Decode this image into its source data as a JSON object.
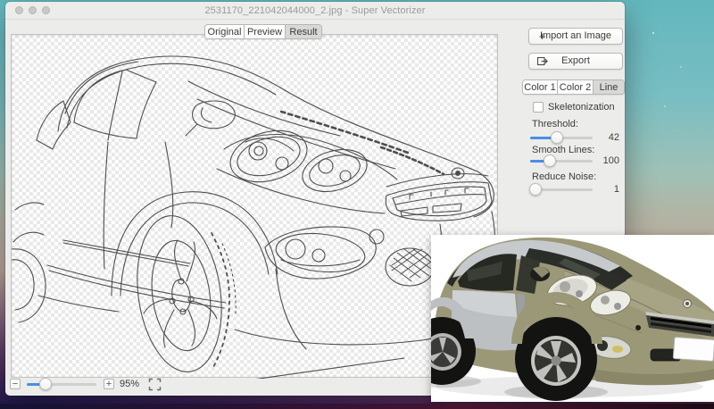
{
  "window": {
    "title": "2531170_221042044000_2.jpg - Super Vectorizer"
  },
  "view_tabs": [
    {
      "label": "Original"
    },
    {
      "label": "Preview"
    },
    {
      "label": "Result"
    }
  ],
  "active_view_tab": "Result",
  "actions": {
    "import_label": "Import an Image",
    "export_label": "Export",
    "import_icon": "+"
  },
  "mode_tabs": [
    {
      "label": "Color 1"
    },
    {
      "label": "Color 2"
    },
    {
      "label": "Line"
    }
  ],
  "active_mode_tab": "Line",
  "settings": {
    "skeletonization": {
      "label": "Skeletonization",
      "checked": false
    },
    "threshold": {
      "label": "Threshold:",
      "value": "42",
      "fill": "43%"
    },
    "smooth_lines": {
      "label": "Smooth Lines:",
      "value": "100",
      "fill": "31%"
    },
    "reduce_noise": {
      "label": "Reduce Noise:",
      "value": "1",
      "fill": "8%"
    }
  },
  "statusbar": {
    "zoom_out_label": "−",
    "zoom_in_label": "+",
    "zoom_level": "95%",
    "zoom_fill": "27%"
  },
  "colors": {
    "accent_blue": "#4a8ee6",
    "window_chrome": "#ececeb",
    "wallpaper_teal": "#63b7be",
    "wallpaper_pink": "#96537b",
    "car_olive": "#9b9878",
    "car_silver": "#c2c6c9"
  }
}
